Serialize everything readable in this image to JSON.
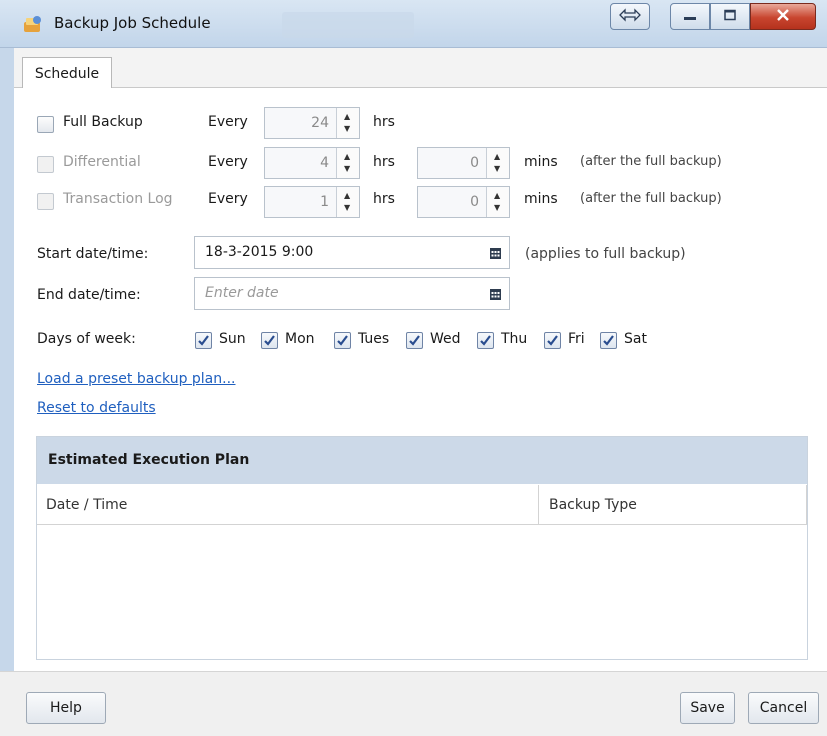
{
  "window": {
    "title": "Backup Job Schedule"
  },
  "tabs": [
    {
      "label": "Schedule",
      "active": true
    }
  ],
  "schedule": {
    "full": {
      "label": "Full Backup",
      "every": "Every",
      "hours": "24",
      "hrs_unit": "hrs",
      "checked": false,
      "enabled": true
    },
    "differential": {
      "label": "Differential",
      "every": "Every",
      "hours": "4",
      "hrs_unit": "hrs",
      "mins": "0",
      "mins_unit": "mins",
      "note": "(after the full backup)",
      "checked": false,
      "enabled": false
    },
    "transaction": {
      "label": "Transaction Log",
      "every": "Every",
      "hours": "1",
      "hrs_unit": "hrs",
      "mins": "0",
      "mins_unit": "mins",
      "note": "(after the full backup)",
      "checked": false,
      "enabled": false
    }
  },
  "start": {
    "label": "Start date/time:",
    "value": "18-3-2015 9:00",
    "note": "(applies to full backup)"
  },
  "end": {
    "label": "End date/time:",
    "placeholder": "Enter date"
  },
  "days": {
    "label": "Days of week:",
    "items": [
      {
        "label": "Sun",
        "checked": true
      },
      {
        "label": "Mon",
        "checked": true
      },
      {
        "label": "Tues",
        "checked": true
      },
      {
        "label": "Wed",
        "checked": true
      },
      {
        "label": "Thu",
        "checked": true
      },
      {
        "label": "Fri",
        "checked": true
      },
      {
        "label": "Sat",
        "checked": true
      }
    ]
  },
  "links": {
    "preset": "Load a preset backup plan...",
    "reset": "Reset to defaults"
  },
  "plan": {
    "title": "Estimated Execution Plan",
    "columns": [
      "Date / Time",
      "Backup Type"
    ],
    "rows": []
  },
  "footer": {
    "help": "Help",
    "save": "Save",
    "cancel": "Cancel"
  },
  "colors": {
    "accent_link": "#1f5fbf",
    "plan_header": "#ccd9e8",
    "check": "#2a4d8f"
  }
}
